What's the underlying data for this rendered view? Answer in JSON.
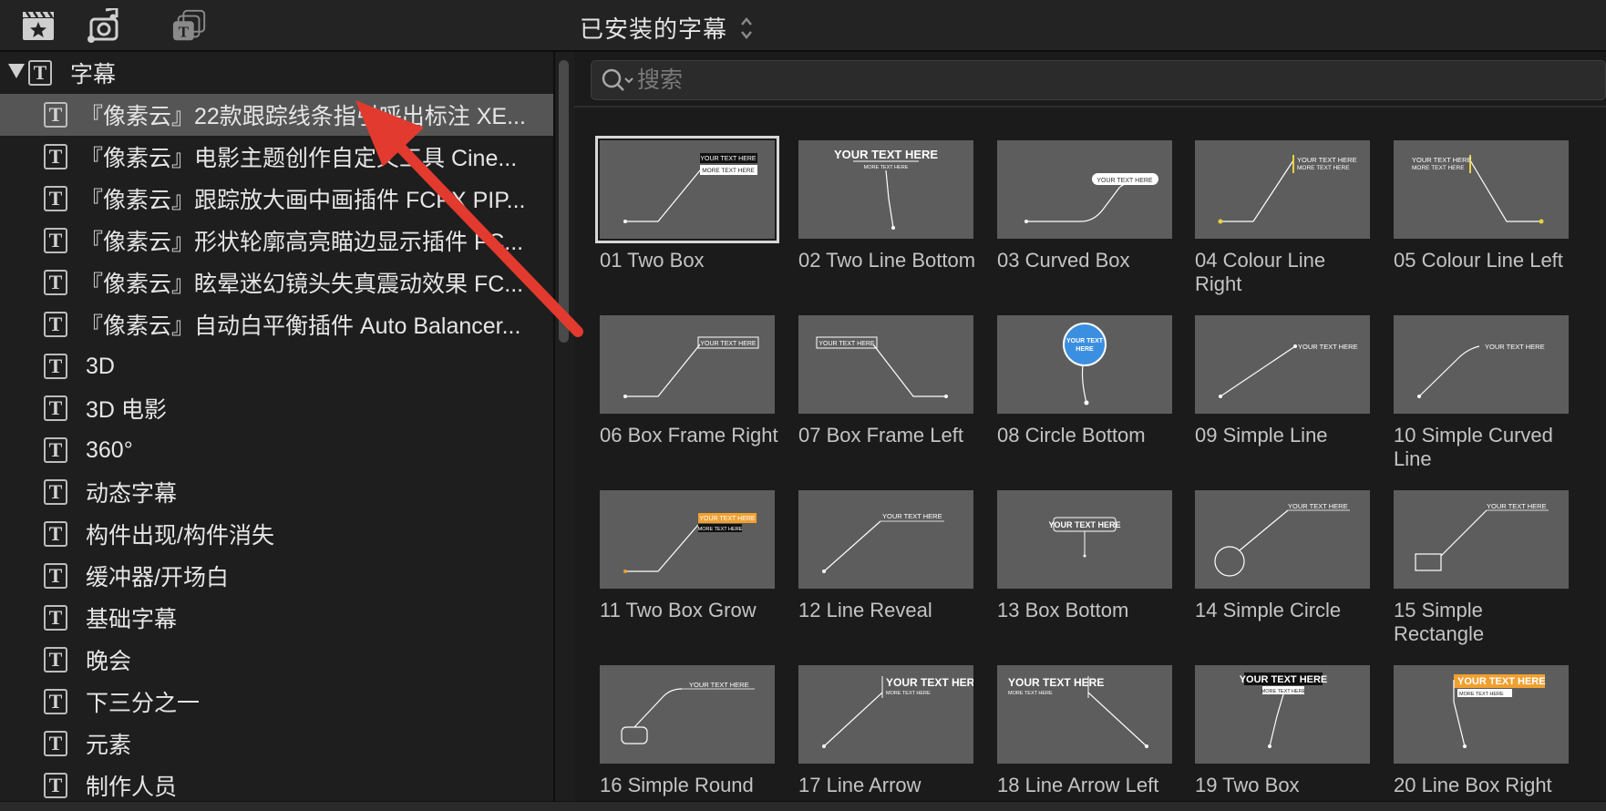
{
  "header": {
    "title": "已安装的字幕",
    "icons": [
      "clapper-star-icon",
      "music-camera-icon",
      "titles-icon"
    ]
  },
  "search": {
    "placeholder": "搜索",
    "value": ""
  },
  "sidebar": {
    "root": {
      "label": "字幕",
      "icon": "text-icon",
      "expanded": true
    },
    "items": [
      {
        "label": "『像素云』22款跟踪线条指引呼出标注 XE..."
      },
      {
        "label": "『像素云』电影主题创作自定义工具 Cine..."
      },
      {
        "label": "『像素云』跟踪放大画中画插件 FCPX PIP..."
      },
      {
        "label": "『像素云』形状轮廓高亮瞄边显示插件 FC..."
      },
      {
        "label": "『像素云』眩晕迷幻镜头失真震动效果 FC..."
      },
      {
        "label": "『像素云』自动白平衡插件 Auto Balancer..."
      },
      {
        "label": "3D"
      },
      {
        "label": "3D 电影"
      },
      {
        "label": "360°"
      },
      {
        "label": "动态字幕"
      },
      {
        "label": "构件出现/构件消失"
      },
      {
        "label": "缓冲器/开场白"
      },
      {
        "label": "基础字幕"
      },
      {
        "label": "晚会"
      },
      {
        "label": "下三分之一"
      },
      {
        "label": "元素"
      },
      {
        "label": "制作人员"
      }
    ],
    "selected_index": 0
  },
  "thumb_text": {
    "your": "YOUR TEXT HERE",
    "more": "MORE TEXT HERE",
    "circle_1": "YOUR TEXT",
    "circle_2": "HERE"
  },
  "colors": {
    "thumb_bg": "#5d5d5d",
    "accent_yellow": "#e8d23a",
    "accent_orange": "#f0a030",
    "circle_blue": "#3b8fe0",
    "arrow_red": "#e23a2e"
  },
  "tiles": [
    {
      "label": "01 Two Box",
      "selected": true
    },
    {
      "label": "02 Two Line Bottom"
    },
    {
      "label": "03 Curved Box"
    },
    {
      "label": "04 Colour Line Right"
    },
    {
      "label": "05 Colour Line Left"
    },
    {
      "label": "06 Box Frame Right"
    },
    {
      "label": "07 Box Frame Left"
    },
    {
      "label": "08 Circle Bottom"
    },
    {
      "label": "09 Simple Line"
    },
    {
      "label": "10 Simple Curved Line"
    },
    {
      "label": "11 Two Box Grow"
    },
    {
      "label": "12 Line Reveal"
    },
    {
      "label": "13 Box Bottom"
    },
    {
      "label": "14 Simple Circle"
    },
    {
      "label": "15 Simple Rectangle"
    },
    {
      "label": "16 Simple Round"
    },
    {
      "label": "17 Line Arrow"
    },
    {
      "label": "18 Line Arrow Left"
    },
    {
      "label": "19 Two Box"
    },
    {
      "label": "20 Line Box Right"
    }
  ]
}
